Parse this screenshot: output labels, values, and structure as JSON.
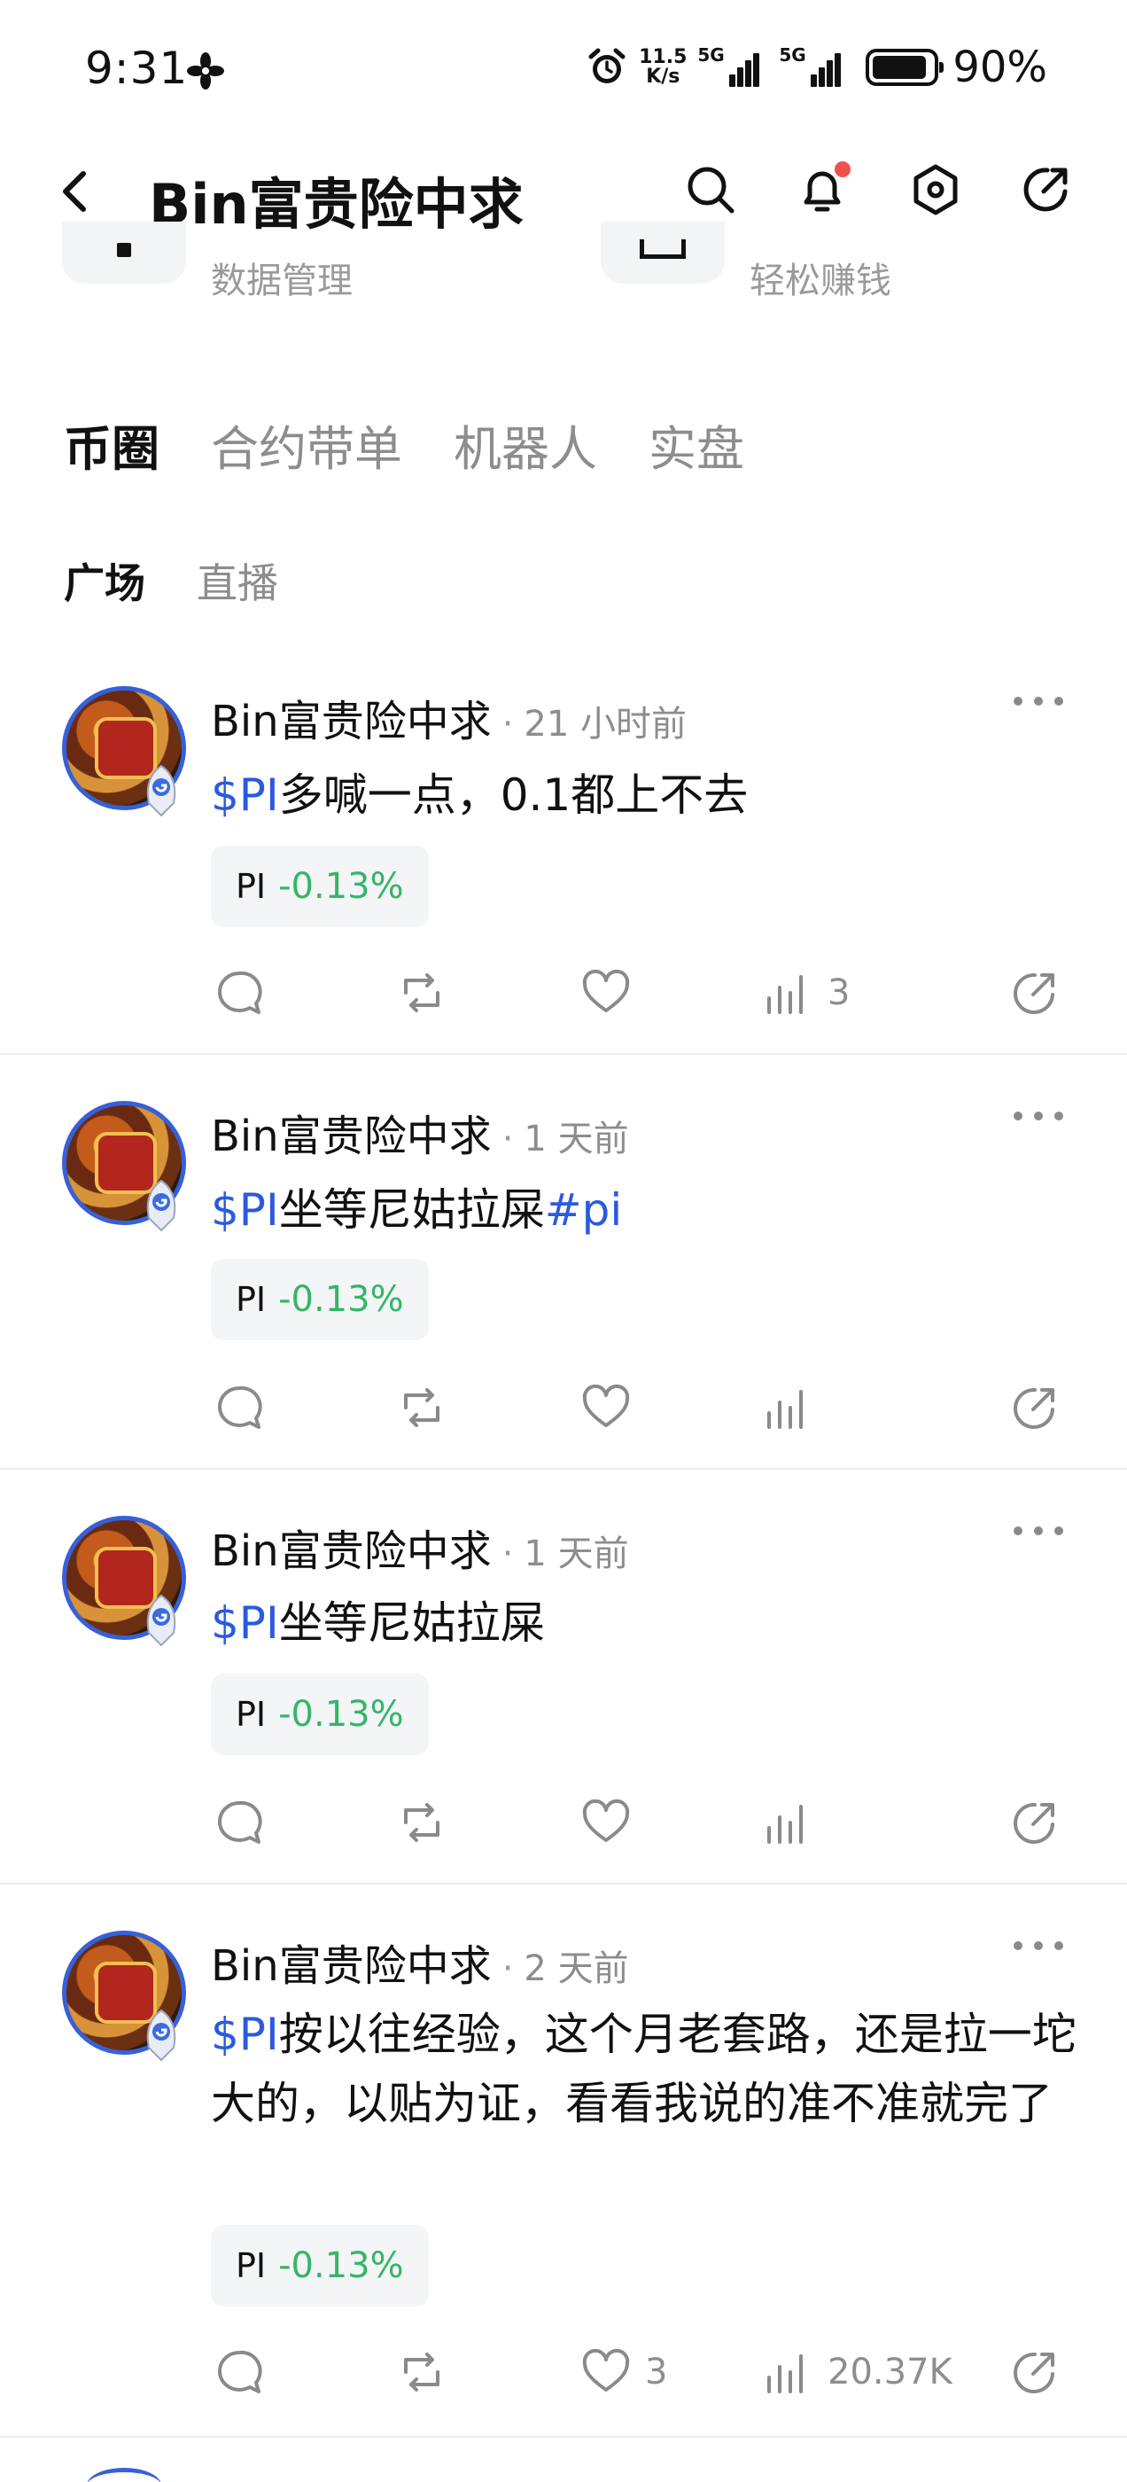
{
  "status_bar": {
    "time": "9:31",
    "net_speed_top": "11.5",
    "net_speed_unit": "K/s",
    "sim1_label": "5G",
    "sim2_label": "5G",
    "battery_percent_text": "90%",
    "battery_level": 0.9
  },
  "header": {
    "title": "Bin富贵险中求"
  },
  "quick_items": [
    {
      "label": "数据管理"
    },
    {
      "label": "轻松赚钱"
    }
  ],
  "tabs": [
    {
      "label": "币圈",
      "active": true
    },
    {
      "label": "合约带单",
      "active": false
    },
    {
      "label": "机器人",
      "active": false
    },
    {
      "label": "实盘",
      "active": false
    }
  ],
  "subtabs": [
    {
      "label": "广场",
      "active": true
    },
    {
      "label": "直播",
      "active": false
    }
  ],
  "posts": [
    {
      "author": "Bin富贵险中求",
      "time": "21 小时前",
      "tag": "$PI",
      "text": "多喊一点，0.1都上不去",
      "tag2": "",
      "chip_symbol": "PI",
      "chip_change": "-0.13%",
      "likes": "",
      "views": "3"
    },
    {
      "author": "Bin富贵险中求",
      "time": "1 天前",
      "tag": "$PI",
      "text": "坐等尼姑拉屎",
      "tag2": "#pi",
      "chip_symbol": "PI",
      "chip_change": "-0.13%",
      "likes": "",
      "views": ""
    },
    {
      "author": "Bin富贵险中求",
      "time": "1 天前",
      "tag": "$PI",
      "text": "坐等尼姑拉屎",
      "tag2": "",
      "chip_symbol": "PI",
      "chip_change": "-0.13%",
      "likes": "",
      "views": ""
    },
    {
      "author": "Bin富贵险中求",
      "time": "2 天前",
      "tag": "$PI",
      "text": "按以往经验，这个月老套路，还是拉一坨大的，以贴为证，看看我说的准不准就完了",
      "tag2": "",
      "chip_symbol": "PI",
      "chip_change": "-0.13%",
      "likes": "3",
      "views": "20.37K"
    }
  ],
  "icons": {
    "back": "back-arrow-icon",
    "search": "search-icon",
    "notification": "bell-icon",
    "settings": "hexagon-settings-icon",
    "share": "share-icon",
    "comment": "comment-icon",
    "repost": "repost-icon",
    "like": "heart-icon",
    "views": "bar-chart-icon",
    "more": "more-dots-icon"
  },
  "colors": {
    "accent_blue": "#2b5ae0",
    "positive_green": "#35b56a",
    "notification_red": "#f24f4f",
    "muted_text": "#8d8d8d"
  }
}
